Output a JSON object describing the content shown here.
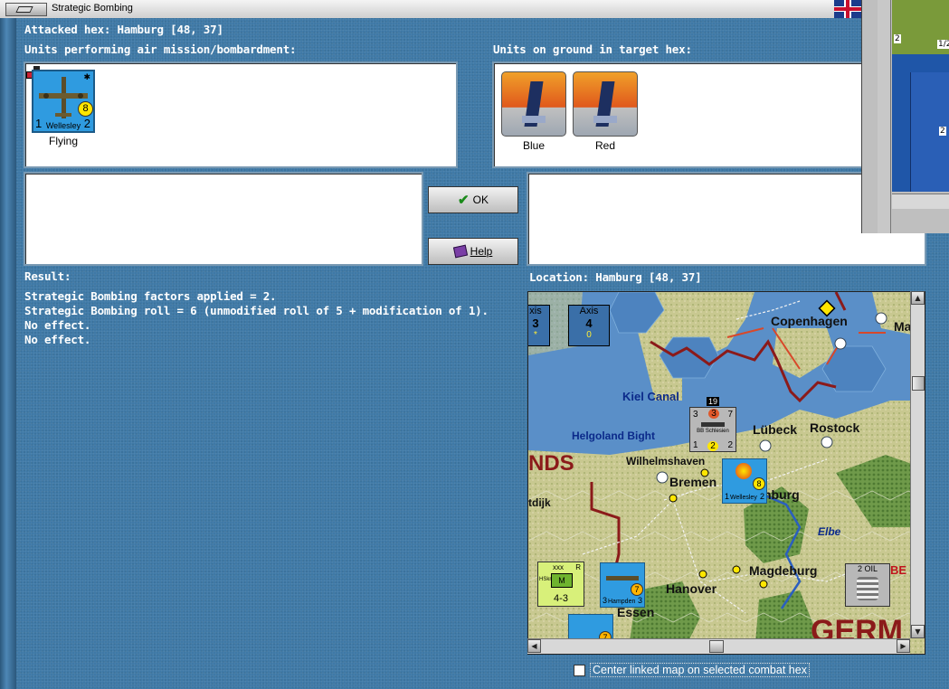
{
  "window": {
    "title": "Strategic Bombing"
  },
  "header": {
    "attacked_hex": "Attacked hex: Hamburg  [48, 37]"
  },
  "air_units": {
    "label": "Units performing air mission/bombardment:",
    "items": [
      {
        "name": "Wellesley",
        "left_value": "1",
        "right_value": "2",
        "circle_value": "8",
        "status": "Flying"
      }
    ]
  },
  "ground_units": {
    "label": "Units on ground in target hex:",
    "items": [
      {
        "status": "Blue"
      },
      {
        "status": "Red"
      }
    ]
  },
  "buttons": {
    "ok": "OK",
    "help": "Help"
  },
  "result": {
    "label": "Result:",
    "lines": [
      "Strategic Bombing factors applied = 2.",
      "Strategic Bombing roll = 6 (unmodified roll of 5 + modification of 1).",
      "No effect.",
      "No effect."
    ]
  },
  "location": {
    "label": "Location:  Hamburg  [48, 37]"
  },
  "map": {
    "places": [
      "Copenhagen",
      "Ma",
      "Kiel Canal",
      "Lübeck",
      "Rostock",
      "Helgoland Bight",
      "Wilhelmshaven",
      "Bremen",
      "nburg",
      "NDS",
      "tdijk",
      "Elbe",
      "Magdeburg",
      "Hanover",
      "Essen",
      "GERM",
      "BE"
    ],
    "axis_box": {
      "title": "Axis",
      "value": "4",
      "sub": "0"
    },
    "left_box": {
      "title": "xis",
      "value": "3",
      "sub": "*"
    },
    "ship": {
      "id": "19",
      "top": [
        "3",
        "3",
        "7"
      ],
      "name": "BB Schlesien",
      "bottom": [
        "1",
        "2",
        "2"
      ]
    },
    "map_bomber": {
      "name": "Wellesley",
      "left_value": "1",
      "right_value": "2",
      "circle_value": "8"
    },
    "hampden": {
      "name": "Hampden",
      "left_value": "3",
      "right_value": "3",
      "circle_value": "7"
    },
    "bottom_bomber_value": "7",
    "corps": {
      "size": "xxx",
      "type": "M",
      "code": "R",
      "factors": "4-3",
      "side": "HSkn"
    },
    "oil": {
      "label": "2 OIL"
    }
  },
  "checkbox": {
    "label": "Center linked map on selected combat hex",
    "checked": false
  },
  "minimap": {
    "labels": [
      "2",
      "1/2",
      "2"
    ]
  }
}
